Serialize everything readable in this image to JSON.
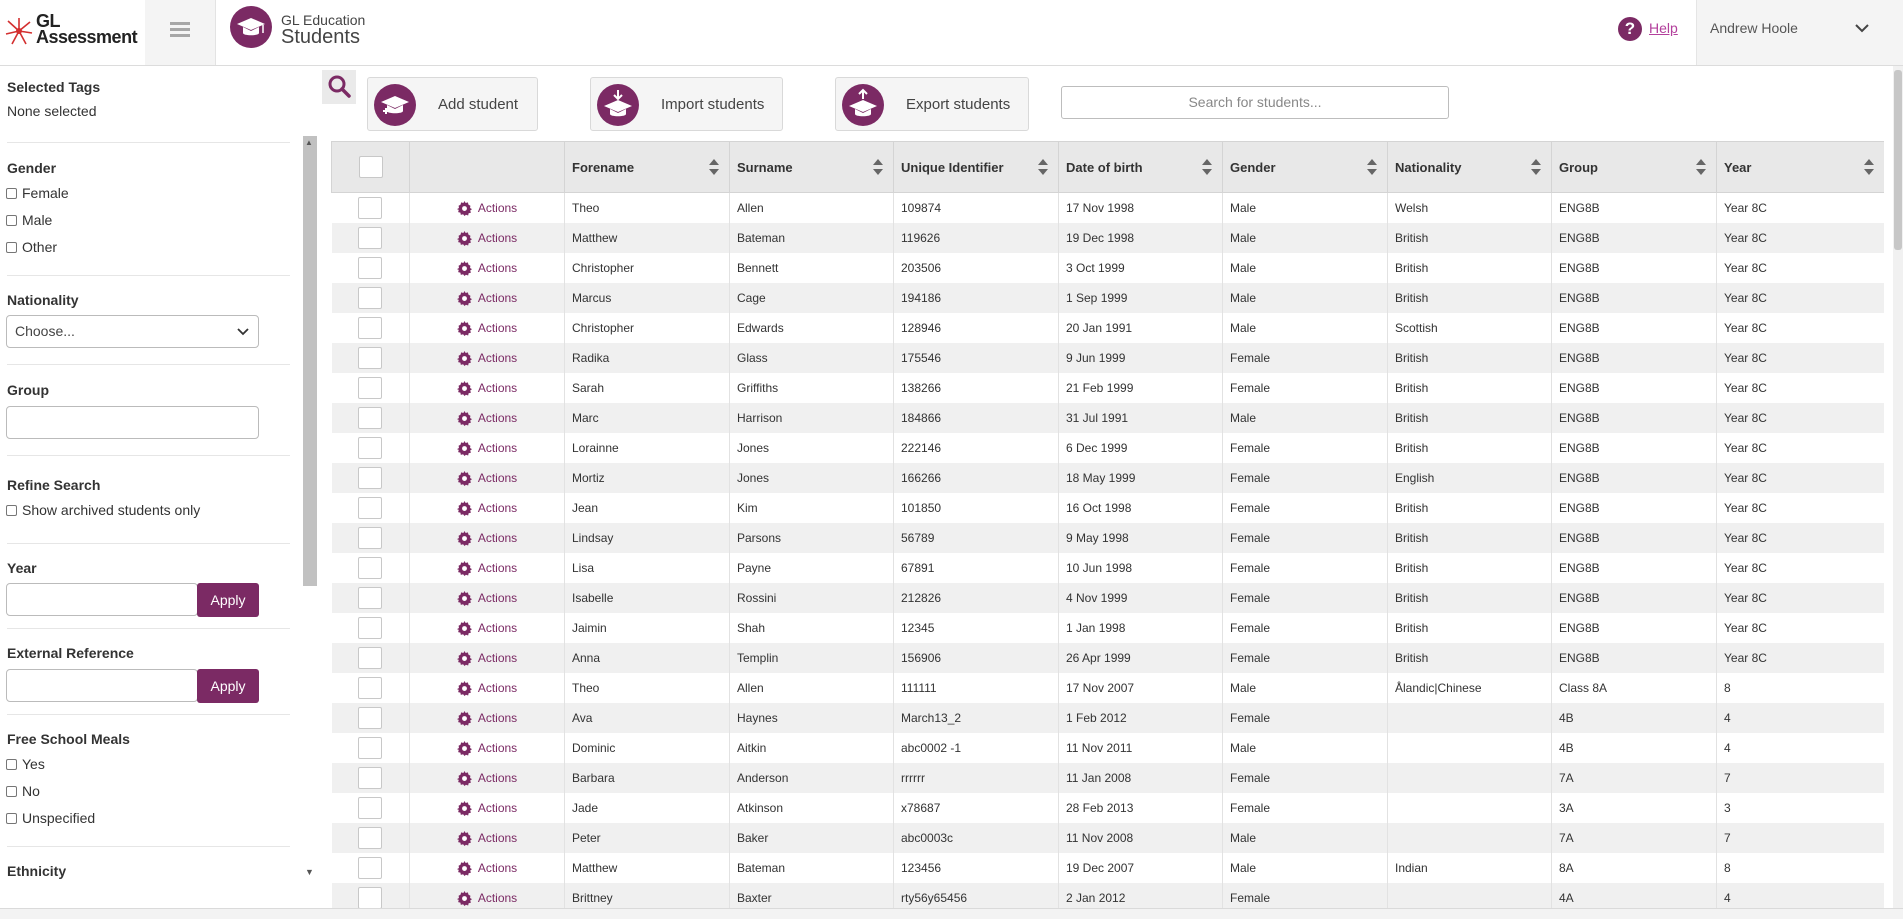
{
  "colors": {
    "accent": "#7b2a64",
    "help_link": "#b3409c"
  },
  "header": {
    "logo_line1": "GL",
    "logo_line2": "Assessment",
    "app_subtitle": "GL Education",
    "app_title": "Students",
    "help_label": "Help",
    "user_name": "Andrew Hoole"
  },
  "sidebar": {
    "selected_tags_title": "Selected Tags",
    "selected_tags_value": "None selected",
    "gender_title": "Gender",
    "gender_options": [
      "Female",
      "Male",
      "Other"
    ],
    "nationality_title": "Nationality",
    "nationality_select": "Choose...",
    "group_title": "Group",
    "refine_title": "Refine Search",
    "archived_label": "Show archived students only",
    "year_title": "Year",
    "apply_label": "Apply",
    "extref_title": "External Reference",
    "fsm_title": "Free School Meals",
    "fsm_options": [
      "Yes",
      "No",
      "Unspecified"
    ],
    "ethnicity_title": "Ethnicity"
  },
  "toolbar": {
    "add_label": "Add student",
    "import_label": "Import students",
    "export_label": "Export students",
    "search_placeholder": "Search for students..."
  },
  "table": {
    "action_label": "Actions",
    "headers": [
      "Forename",
      "Surname",
      "Unique Identifier",
      "Date of birth",
      "Gender",
      "Nationality",
      "Group",
      "Year"
    ],
    "rows": [
      [
        "Theo",
        "Allen",
        "109874",
        "17 Nov 1998",
        "Male",
        "Welsh",
        "ENG8B",
        "Year 8C"
      ],
      [
        "Matthew",
        "Bateman",
        "119626",
        "19 Dec 1998",
        "Male",
        "British",
        "ENG8B",
        "Year 8C"
      ],
      [
        "Christopher",
        "Bennett",
        "203506",
        "3 Oct 1999",
        "Male",
        "British",
        "ENG8B",
        "Year 8C"
      ],
      [
        "Marcus",
        "Cage",
        "194186",
        "1 Sep 1999",
        "Male",
        "British",
        "ENG8B",
        "Year 8C"
      ],
      [
        "Christopher",
        "Edwards",
        "128946",
        "20 Jan 1991",
        "Male",
        "Scottish",
        "ENG8B",
        "Year 8C"
      ],
      [
        "Radika",
        "Glass",
        "175546",
        "9 Jun 1999",
        "Female",
        "British",
        "ENG8B",
        "Year 8C"
      ],
      [
        "Sarah",
        "Griffiths",
        "138266",
        "21 Feb 1999",
        "Female",
        "British",
        "ENG8B",
        "Year 8C"
      ],
      [
        "Marc",
        "Harrison",
        "184866",
        "31 Jul 1991",
        "Male",
        "British",
        "ENG8B",
        "Year 8C"
      ],
      [
        "Lorainne",
        "Jones",
        "222146",
        "6 Dec 1999",
        "Female",
        "British",
        "ENG8B",
        "Year 8C"
      ],
      [
        "Mortiz",
        "Jones",
        "166266",
        "18 May 1999",
        "Female",
        "English",
        "ENG8B",
        "Year 8C"
      ],
      [
        "Jean",
        "Kim",
        "101850",
        "16 Oct 1998",
        "Female",
        "British",
        "ENG8B",
        "Year 8C"
      ],
      [
        "Lindsay",
        "Parsons",
        "56789",
        "9 May 1998",
        "Female",
        "British",
        "ENG8B",
        "Year 8C"
      ],
      [
        "Lisa",
        "Payne",
        "67891",
        "10 Jun 1998",
        "Female",
        "British",
        "ENG8B",
        "Year 8C"
      ],
      [
        "Isabelle",
        "Rossini",
        "212826",
        "4 Nov 1999",
        "Female",
        "British",
        "ENG8B",
        "Year 8C"
      ],
      [
        "Jaimin",
        "Shah",
        "12345",
        "1 Jan 1998",
        "Female",
        "British",
        "ENG8B",
        "Year 8C"
      ],
      [
        "Anna",
        "Templin",
        "156906",
        "26 Apr 1999",
        "Female",
        "British",
        "ENG8B",
        "Year 8C"
      ],
      [
        "Theo",
        "Allen",
        "111111",
        "17 Nov 2007",
        "Male",
        "Ålandic|Chinese",
        "Class 8A",
        "8"
      ],
      [
        "Ava",
        "Haynes",
        "March13_2",
        "1 Feb 2012",
        "Female",
        "",
        "4B",
        "4"
      ],
      [
        "Dominic",
        "Aitkin",
        "abc0002 -1",
        "11 Nov 2011",
        "Male",
        "",
        "4B",
        "4"
      ],
      [
        "Barbara",
        "Anderson",
        "rrrrrr",
        "11 Jan 2008",
        "Female",
        "",
        "7A",
        "7"
      ],
      [
        "Jade",
        "Atkinson",
        "x78687",
        "28 Feb 2013",
        "Female",
        "",
        "3A",
        "3"
      ],
      [
        "Peter",
        "Baker",
        "abc0003c",
        "11 Nov 2008",
        "Male",
        "",
        "7A",
        "7"
      ],
      [
        "Matthew",
        "Bateman",
        "123456",
        "19 Dec 2007",
        "Male",
        "Indian",
        "8A",
        "8"
      ],
      [
        "Brittney",
        "Baxter",
        "rty56y65456",
        "2 Jan 2012",
        "Female",
        "",
        "4A",
        "4"
      ]
    ]
  }
}
